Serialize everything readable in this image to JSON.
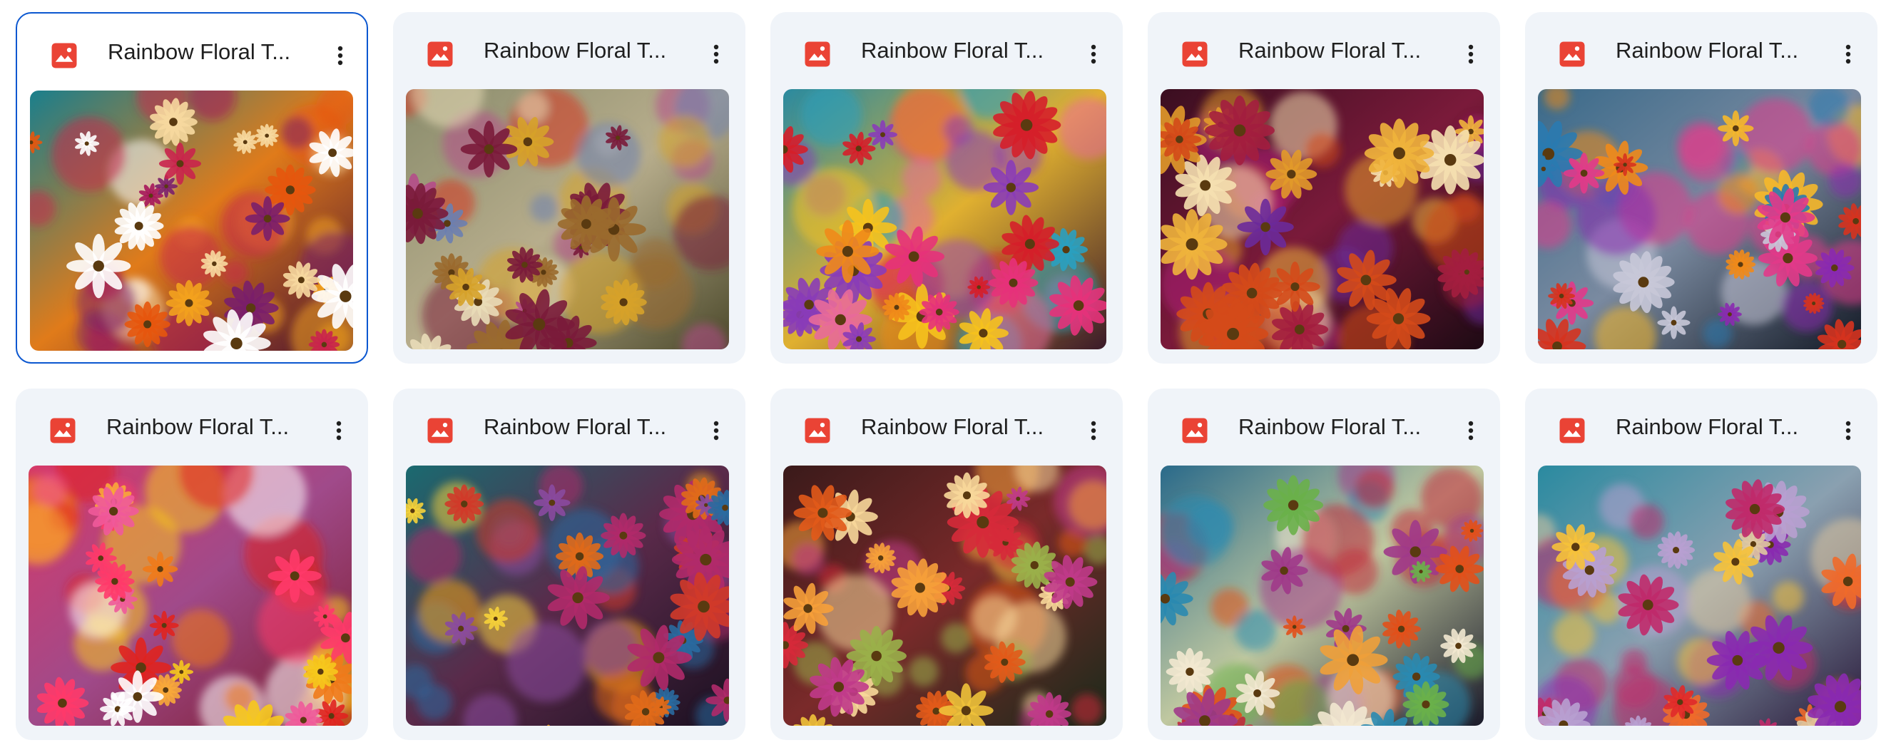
{
  "files": [
    {
      "title": "Rainbow Floral T...",
      "icon": "image-file-icon",
      "selected": true,
      "palette": {
        "bg": [
          "#1a7f8c",
          "#e07b1a",
          "#4a1230"
        ],
        "flowers": [
          "#ffffff",
          "#f3a21e",
          "#a6175a",
          "#e5560d",
          "#7a1f6a",
          "#f7d9a0",
          "#c9244d"
        ]
      }
    },
    {
      "title": "Rainbow Floral T...",
      "icon": "image-file-icon",
      "selected": false,
      "palette": {
        "bg": [
          "#8a8c6c",
          "#b7ad8c",
          "#4d4a2c"
        ],
        "flowers": [
          "#7a1b3a",
          "#d6331f",
          "#e9dcb8",
          "#b54d8a",
          "#d6a22a",
          "#6b7fb0",
          "#9a6a2e"
        ]
      }
    },
    {
      "title": "Rainbow Floral T...",
      "icon": "image-file-icon",
      "selected": false,
      "palette": {
        "bg": [
          "#2a8aa0",
          "#e0b030",
          "#3a1a2a"
        ],
        "flowers": [
          "#f6c21d",
          "#e5327a",
          "#d51f2a",
          "#8a3cb8",
          "#f08a1a",
          "#2aa0c0",
          "#e86a9a"
        ]
      }
    },
    {
      "title": "Rainbow Floral T...",
      "icon": "image-file-icon",
      "selected": false,
      "palette": {
        "bg": [
          "#3a0e20",
          "#7a1a3a",
          "#1e0a14"
        ],
        "flowers": [
          "#f5e0b0",
          "#e29a2a",
          "#b0207a",
          "#d44a1a",
          "#6b2a9a",
          "#a31e3f",
          "#f0b43c"
        ]
      }
    },
    {
      "title": "Rainbow Floral T...",
      "icon": "image-file-icon",
      "selected": false,
      "palette": {
        "bg": [
          "#3a6a8a",
          "#7a8aa0",
          "#141a26"
        ],
        "flowers": [
          "#f08a1a",
          "#e23a8a",
          "#c8c8d8",
          "#f6b82a",
          "#8a2ab0",
          "#d6331f",
          "#2a7ab0"
        ]
      }
    },
    {
      "title": "Rainbow Floral T...",
      "icon": "image-file-icon",
      "selected": false,
      "palette": {
        "bg": [
          "#d63a6a",
          "#a04a8a",
          "#7a1a2a"
        ],
        "flowers": [
          "#f6c81d",
          "#f05a9a",
          "#ff3a6a",
          "#f07a1a",
          "#ffffff",
          "#e0231f",
          "#f8a83a"
        ]
      }
    },
    {
      "title": "Rainbow Floral T...",
      "icon": "image-file-icon",
      "selected": false,
      "palette": {
        "bg": [
          "#1a6a70",
          "#5a2a4a",
          "#1a1020"
        ],
        "flowers": [
          "#f0a01a",
          "#b02a6a",
          "#e06a1a",
          "#8a4aa0",
          "#f6d23a",
          "#2a6aa0",
          "#d03a2a"
        ]
      }
    },
    {
      "title": "Rainbow Floral T...",
      "icon": "image-file-icon",
      "selected": false,
      "palette": {
        "bg": [
          "#3a1a1a",
          "#7a2a2a",
          "#1a2a1a"
        ],
        "flowers": [
          "#f6a03a",
          "#e25a1a",
          "#d62a3a",
          "#f0c23a",
          "#c03a8a",
          "#9ab04a",
          "#f8d89a"
        ]
      }
    },
    {
      "title": "Rainbow Floral T...",
      "icon": "image-file-icon",
      "selected": false,
      "palette": {
        "bg": [
          "#2a6a8a",
          "#c0c8a0",
          "#1a1a2a"
        ],
        "flowers": [
          "#f2e8d0",
          "#e2501a",
          "#c02a3a",
          "#f0a03a",
          "#2a8ab0",
          "#a03a8a",
          "#6ab04a"
        ]
      }
    },
    {
      "title": "Rainbow Floral T...",
      "icon": "image-file-icon",
      "selected": false,
      "palette": {
        "bg": [
          "#2a8aa0",
          "#8aa0b0",
          "#2a1a3a"
        ],
        "flowers": [
          "#e02a2a",
          "#f06a2a",
          "#b8a0d0",
          "#f6c23a",
          "#8a2ab0",
          "#e0c8a0",
          "#c02a6a"
        ]
      }
    }
  ]
}
